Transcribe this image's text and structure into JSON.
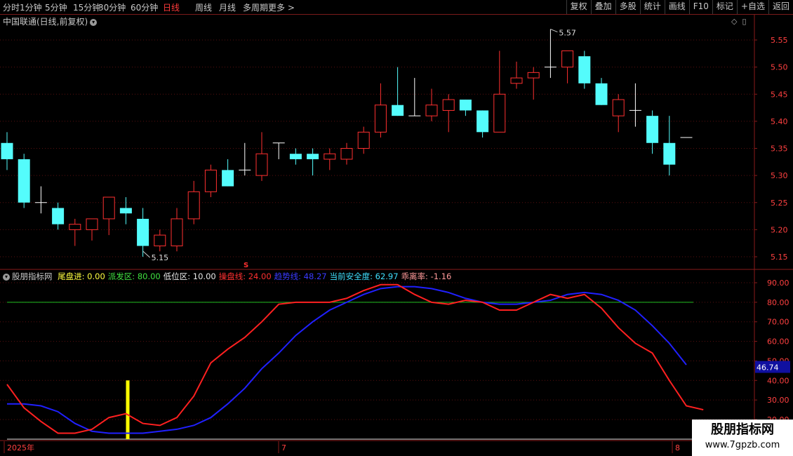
{
  "toolbar": {
    "periods": [
      "分时",
      "1分钟",
      "5分钟",
      "15分钟",
      "30分钟",
      "60分钟",
      "日线",
      "周线",
      "月线",
      "多周期",
      "更多 >"
    ],
    "active_period": "日线",
    "right_buttons": [
      "复权",
      "叠加",
      "多股",
      "统计",
      "画线",
      "F10",
      "标记",
      "+自选",
      "返回"
    ]
  },
  "stock": {
    "title": "中国联通(日线,前复权)"
  },
  "price_axis": {
    "ticks": [
      "5.55",
      "5.50",
      "5.45",
      "5.40",
      "5.35",
      "5.30",
      "5.25",
      "5.20",
      "5.15"
    ]
  },
  "annotations": {
    "high": "5.57",
    "low": "5.15",
    "marker": "S"
  },
  "indicator": {
    "name": "股朋指标网",
    "items": [
      {
        "label": "尾盘进:",
        "value": "0.00",
        "color": "#ffff40"
      },
      {
        "label": "派发区:",
        "value": "80.00",
        "color": "#40e040"
      },
      {
        "label": "低位区:",
        "value": "10.00",
        "color": "#e8e8e8"
      },
      {
        "label": "操盘线:",
        "value": "24.00",
        "color": "#ff3030"
      },
      {
        "label": "趋势线:",
        "value": "48.27",
        "color": "#3a3aff"
      },
      {
        "label": "当前安全度:",
        "value": "62.97",
        "color": "#40e0ff"
      },
      {
        "label": "乖离率:",
        "value": "-1.16",
        "color": "#ff9a9a"
      }
    ],
    "axis_ticks": [
      "90.00",
      "80.00",
      "70.00",
      "60.00",
      "50.00",
      "40.00",
      "30.00",
      "20.00"
    ],
    "current_value": "46.74"
  },
  "date_axis": {
    "labels": [
      "2025年",
      "7",
      "8"
    ]
  },
  "watermark": {
    "line1": "股朋指标网",
    "line2": "www.7gpzb.com"
  },
  "colors": {
    "up": "#ff3030",
    "down": "#54fcfc",
    "red_line": "#ff2020",
    "blue_line": "#2020ff",
    "green_line": "#20c020",
    "yellow_bar": "#ffff00"
  },
  "chart_data": [
    {
      "type": "candlestick",
      "title": "中国联通(日线,前复权)",
      "ylim": [
        5.13,
        5.58
      ],
      "candles": [
        {
          "o": 5.36,
          "h": 5.38,
          "l": 5.31,
          "c": 5.33
        },
        {
          "o": 5.33,
          "h": 5.34,
          "l": 5.24,
          "c": 5.25
        },
        {
          "o": 5.25,
          "h": 5.28,
          "l": 5.23,
          "c": 5.25
        },
        {
          "o": 5.24,
          "h": 5.25,
          "l": 5.2,
          "c": 5.21
        },
        {
          "o": 5.2,
          "h": 5.22,
          "l": 5.17,
          "c": 5.21
        },
        {
          "o": 5.2,
          "h": 5.22,
          "l": 5.18,
          "c": 5.22
        },
        {
          "o": 5.22,
          "h": 5.26,
          "l": 5.19,
          "c": 5.26
        },
        {
          "o": 5.24,
          "h": 5.26,
          "l": 5.21,
          "c": 5.23
        },
        {
          "o": 5.22,
          "h": 5.24,
          "l": 5.15,
          "c": 5.17
        },
        {
          "o": 5.17,
          "h": 5.2,
          "l": 5.16,
          "c": 5.19
        },
        {
          "o": 5.17,
          "h": 5.24,
          "l": 5.16,
          "c": 5.22
        },
        {
          "o": 5.22,
          "h": 5.29,
          "l": 5.21,
          "c": 5.27
        },
        {
          "o": 5.27,
          "h": 5.32,
          "l": 5.26,
          "c": 5.31
        },
        {
          "o": 5.31,
          "h": 5.33,
          "l": 5.28,
          "c": 5.28
        },
        {
          "o": 5.31,
          "h": 5.36,
          "l": 5.3,
          "c": 5.31
        },
        {
          "o": 5.3,
          "h": 5.38,
          "l": 5.29,
          "c": 5.34
        },
        {
          "o": 5.36,
          "h": 5.36,
          "l": 5.33,
          "c": 5.36
        },
        {
          "o": 5.34,
          "h": 5.35,
          "l": 5.32,
          "c": 5.33
        },
        {
          "o": 5.34,
          "h": 5.35,
          "l": 5.3,
          "c": 5.33
        },
        {
          "o": 5.33,
          "h": 5.35,
          "l": 5.31,
          "c": 5.34
        },
        {
          "o": 5.33,
          "h": 5.36,
          "l": 5.32,
          "c": 5.35
        },
        {
          "o": 5.35,
          "h": 5.39,
          "l": 5.34,
          "c": 5.38
        },
        {
          "o": 5.38,
          "h": 5.47,
          "l": 5.37,
          "c": 5.43
        },
        {
          "o": 5.43,
          "h": 5.5,
          "l": 5.41,
          "c": 5.41
        },
        {
          "o": 5.41,
          "h": 5.48,
          "l": 5.41,
          "c": 5.41
        },
        {
          "o": 5.41,
          "h": 5.46,
          "l": 5.4,
          "c": 5.43
        },
        {
          "o": 5.42,
          "h": 5.45,
          "l": 5.38,
          "c": 5.44
        },
        {
          "o": 5.44,
          "h": 5.44,
          "l": 5.41,
          "c": 5.42
        },
        {
          "o": 5.42,
          "h": 5.42,
          "l": 5.37,
          "c": 5.38
        },
        {
          "o": 5.38,
          "h": 5.53,
          "l": 5.38,
          "c": 5.45
        },
        {
          "o": 5.47,
          "h": 5.51,
          "l": 5.46,
          "c": 5.48
        },
        {
          "o": 5.48,
          "h": 5.5,
          "l": 5.44,
          "c": 5.49
        },
        {
          "o": 5.5,
          "h": 5.57,
          "l": 5.48,
          "c": 5.5
        },
        {
          "o": 5.5,
          "h": 5.53,
          "l": 5.47,
          "c": 5.53
        },
        {
          "o": 5.52,
          "h": 5.53,
          "l": 5.46,
          "c": 5.47
        },
        {
          "o": 5.47,
          "h": 5.48,
          "l": 5.43,
          "c": 5.43
        },
        {
          "o": 5.41,
          "h": 5.45,
          "l": 5.38,
          "c": 5.44
        },
        {
          "o": 5.42,
          "h": 5.47,
          "l": 5.39,
          "c": 5.42
        },
        {
          "o": 5.41,
          "h": 5.42,
          "l": 5.34,
          "c": 5.36
        },
        {
          "o": 5.36,
          "h": 5.41,
          "l": 5.3,
          "c": 5.32
        },
        {
          "o": 5.37,
          "h": 5.37,
          "l": 5.37,
          "c": 5.37
        }
      ]
    },
    {
      "type": "line",
      "title": "股朋指标网",
      "ylim": [
        17,
        93
      ],
      "series": [
        {
          "name": "操盘线",
          "values": [
            38,
            26,
            19,
            13,
            13,
            15,
            21,
            23,
            18,
            17,
            21,
            32,
            49,
            56,
            62,
            70,
            79,
            80,
            80,
            80,
            82,
            86,
            89,
            89,
            84,
            80,
            79,
            81,
            80,
            76,
            76,
            80,
            84,
            82,
            84,
            77,
            67,
            59,
            54,
            40,
            27,
            25
          ]
        },
        {
          "name": "趋势线",
          "values": [
            28,
            28,
            27,
            24,
            18,
            14,
            13,
            13,
            13,
            14,
            15,
            17,
            21,
            28,
            36,
            46,
            54,
            63,
            70,
            76,
            80,
            84,
            87,
            88,
            88,
            87,
            85,
            82,
            80,
            79,
            79,
            80,
            81,
            84,
            85,
            84,
            81,
            76,
            68,
            59,
            48
          ]
        },
        {
          "name": "派发区",
          "values": [
            80
          ]
        },
        {
          "name": "尾盘进",
          "values": [
            40
          ]
        }
      ]
    }
  ]
}
